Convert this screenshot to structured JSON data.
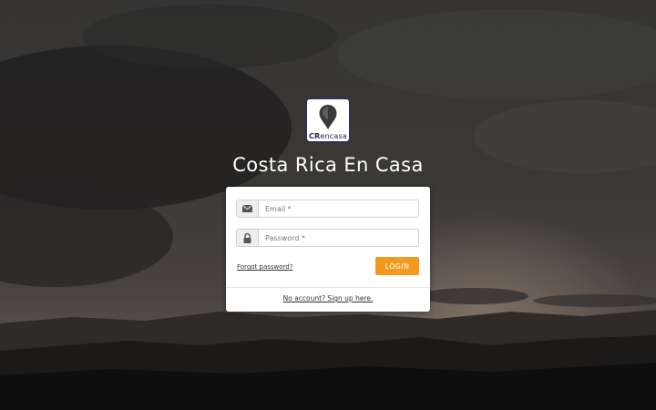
{
  "logo": {
    "text_bold": "CR",
    "text_light": "encasa",
    "colors": {
      "frame": "#2f2f5a",
      "pin": "#3a3a3a"
    }
  },
  "site_title": "Costa Rica En Casa",
  "login_form": {
    "email": {
      "placeholder": "Email *",
      "value": "",
      "icon": "envelope-icon"
    },
    "password": {
      "placeholder": "Password *",
      "value": "",
      "icon": "lock-icon"
    },
    "forgot_password_label": "Forgot password?",
    "login_button_label": "LOGIN",
    "signup_link_label": "No account? Sign up here."
  },
  "colors": {
    "accent": "#f39a1e",
    "title_text": "#ffffff",
    "card_background": "#ffffff"
  }
}
